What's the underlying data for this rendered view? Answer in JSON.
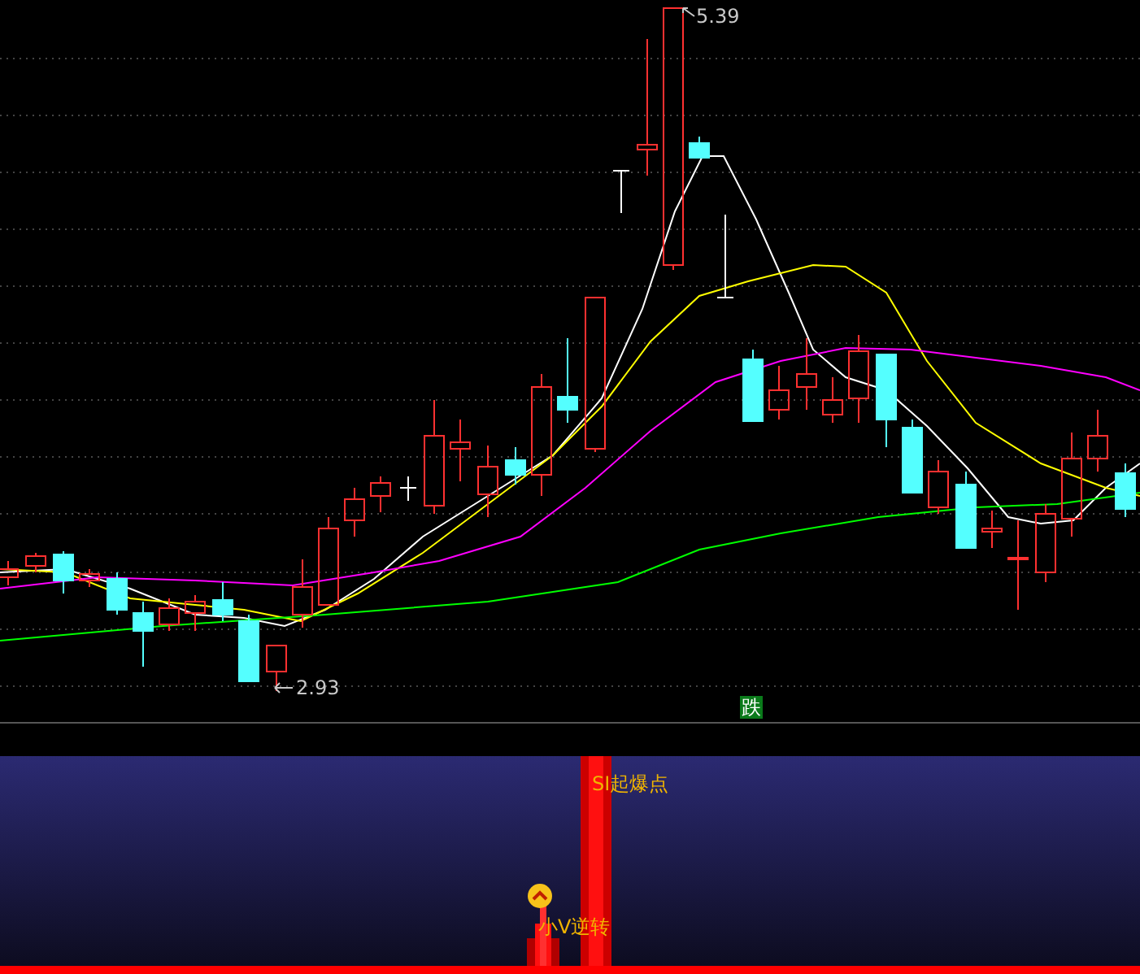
{
  "main_chart": {
    "high_price_label": "5.39",
    "low_price_label": "2.93",
    "signal_badge": "跌"
  },
  "indicator_panel": {
    "signals": [
      {
        "kind": "burst",
        "label": "SI起爆点"
      },
      {
        "kind": "reversal",
        "label": "小V逆转"
      }
    ]
  }
}
